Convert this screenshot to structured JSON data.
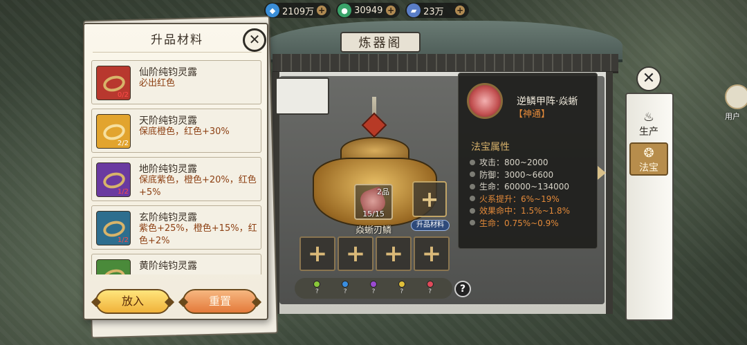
{
  "resources": [
    {
      "icon": "spirit-stone-icon",
      "value": "2109万",
      "color": "#3a8ed8"
    },
    {
      "icon": "jade-orb-icon",
      "value": "30949",
      "color": "#3aa46a"
    },
    {
      "icon": "crystal-ore-icon",
      "value": "23万",
      "color": "#5a7ec8"
    }
  ],
  "resource_plus": "+",
  "shop": {
    "sign": "炼器阁"
  },
  "material_panel": {
    "title": "升品材料",
    "close": "✕",
    "items": [
      {
        "name": "仙阶纯钧灵露",
        "desc": "必出红色",
        "count": "0/2",
        "count_color": "#ff4a4a",
        "bg": "#b8382e"
      },
      {
        "name": "天阶纯钧灵露",
        "desc": "保底橙色，红色+30%",
        "count": "2/2",
        "count_color": "#ffffff",
        "bg": "#e2a42e"
      },
      {
        "name": "地阶纯钧灵露",
        "desc": "保底紫色，橙色+20%，红色+5%",
        "count": "1/2",
        "count_color": "#ff4a4a",
        "bg": "#6a3aa0"
      },
      {
        "name": "玄阶纯钧灵露",
        "desc": "紫色+25%，橙色+15%，红色+2%",
        "count": "1/2",
        "count_color": "#ff4a4a",
        "bg": "#2e6e8e"
      },
      {
        "name": "黄阶纯钧灵露",
        "desc": "",
        "count": "",
        "count_color": "#ffffff",
        "bg": "#4a8a3a"
      }
    ],
    "put_button": "放入",
    "reset_button": "重置"
  },
  "forge": {
    "item_grade": "2品",
    "item_count": "15/15",
    "item_name": "焱蜥刃鳞",
    "upgrade_tag": "升品材料",
    "slot_symbol": "+",
    "gems": [
      {
        "label": "?",
        "color": "#8ac83a"
      },
      {
        "label": "?",
        "color": "#3a8ee0"
      },
      {
        "label": "?",
        "color": "#9a4ad0"
      },
      {
        "label": "?",
        "color": "#e0c03a"
      },
      {
        "label": "?",
        "color": "#e04a5a"
      }
    ],
    "help": "?"
  },
  "treasure": {
    "name": "逆鳞甲阵·焱蜥",
    "type": "【神通】",
    "attr_title": "法宝属性",
    "attrs": [
      {
        "text": "攻击：800~2000",
        "color": "#d8d4c8"
      },
      {
        "text": "防御：3000~6600",
        "color": "#d8d4c8"
      },
      {
        "text": "生命：60000~134000",
        "color": "#d8d4c8"
      },
      {
        "text": "火系提升：6%~19%",
        "color": "#e38a3a"
      },
      {
        "text": "效果命中：1.5%~1.8%",
        "color": "#e38a3a"
      },
      {
        "text": "生命：0.75%~0.9%",
        "color": "#e38a3a"
      }
    ]
  },
  "side_tabs": [
    {
      "icon": "cauldron-icon",
      "glyph": "♨",
      "label": "生产",
      "active": false
    },
    {
      "icon": "treasure-icon",
      "glyph": "❂",
      "label": "法宝",
      "active": true
    }
  ],
  "side_close": "✕",
  "user_label": "用户"
}
